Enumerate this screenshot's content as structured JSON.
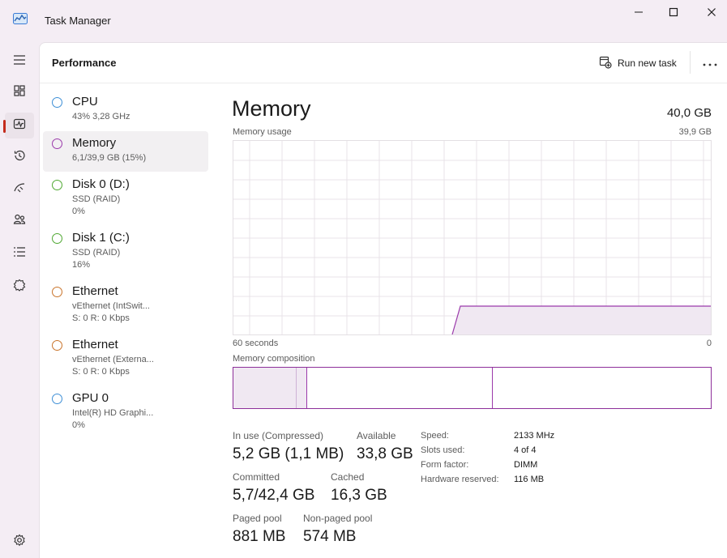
{
  "window": {
    "title": "Task Manager"
  },
  "header": {
    "title": "Performance",
    "run_new_task": "Run new task"
  },
  "rail": {
    "items": [
      {
        "icon": "hamburger-menu-icon"
      },
      {
        "icon": "processes-icon"
      },
      {
        "icon": "performance-icon",
        "active": true
      },
      {
        "icon": "app-history-icon"
      },
      {
        "icon": "startup-apps-icon"
      },
      {
        "icon": "users-icon"
      },
      {
        "icon": "details-icon"
      },
      {
        "icon": "services-icon"
      },
      {
        "icon": "settings-icon"
      }
    ]
  },
  "devices": [
    {
      "name": "CPU",
      "sub1": "43%  3,28 GHz",
      "color": "#3e8fd6"
    },
    {
      "name": "Memory",
      "sub1": "6,1/39,9 GB (15%)",
      "color": "#9b3aab",
      "selected": true
    },
    {
      "name": "Disk 0 (D:)",
      "sub1": "SSD (RAID)",
      "sub2": "0%",
      "color": "#4fa832"
    },
    {
      "name": "Disk 1 (C:)",
      "sub1": "SSD (RAID)",
      "sub2": "16%",
      "color": "#4fa832"
    },
    {
      "name": "Ethernet",
      "sub1": "vEthernet (IntSwit...",
      "sub2": "S: 0  R: 0 Kbps",
      "color": "#c9742b"
    },
    {
      "name": "Ethernet",
      "sub1": "vEthernet (Externa...",
      "sub2": "S: 0  R: 0 Kbps",
      "color": "#c9742b"
    },
    {
      "name": "GPU 0",
      "sub1": "Intel(R) HD Graphi...",
      "sub2": "0%",
      "color": "#3e8fd6"
    }
  ],
  "detail": {
    "title": "Memory",
    "total": "40,0 GB",
    "usage_label": "Memory usage",
    "usage_max": "39,9 GB",
    "time_left": "60 seconds",
    "time_right": "0",
    "composition_label": "Memory composition",
    "stats": {
      "in_use_label": "In use (Compressed)",
      "in_use_value": "5,2 GB (1,1 MB)",
      "available_label": "Available",
      "available_value": "33,8 GB",
      "committed_label": "Committed",
      "committed_value": "5,7/42,4 GB",
      "cached_label": "Cached",
      "cached_value": "16,3 GB",
      "paged_label": "Paged pool",
      "paged_value": "881 MB",
      "nonpaged_label": "Non-paged pool",
      "nonpaged_value": "574 MB"
    },
    "specs": {
      "speed_label": "Speed:",
      "speed_value": "2133 MHz",
      "slots_label": "Slots used:",
      "slots_value": "4 of 4",
      "form_label": "Form factor:",
      "form_value": "DIMM",
      "reserved_label": "Hardware reserved:",
      "reserved_value": "116 MB"
    }
  },
  "colors": {
    "memory": "#9b3aab",
    "memory_fill": "#f0e8f2",
    "close_accent": "#c42b1c"
  }
}
